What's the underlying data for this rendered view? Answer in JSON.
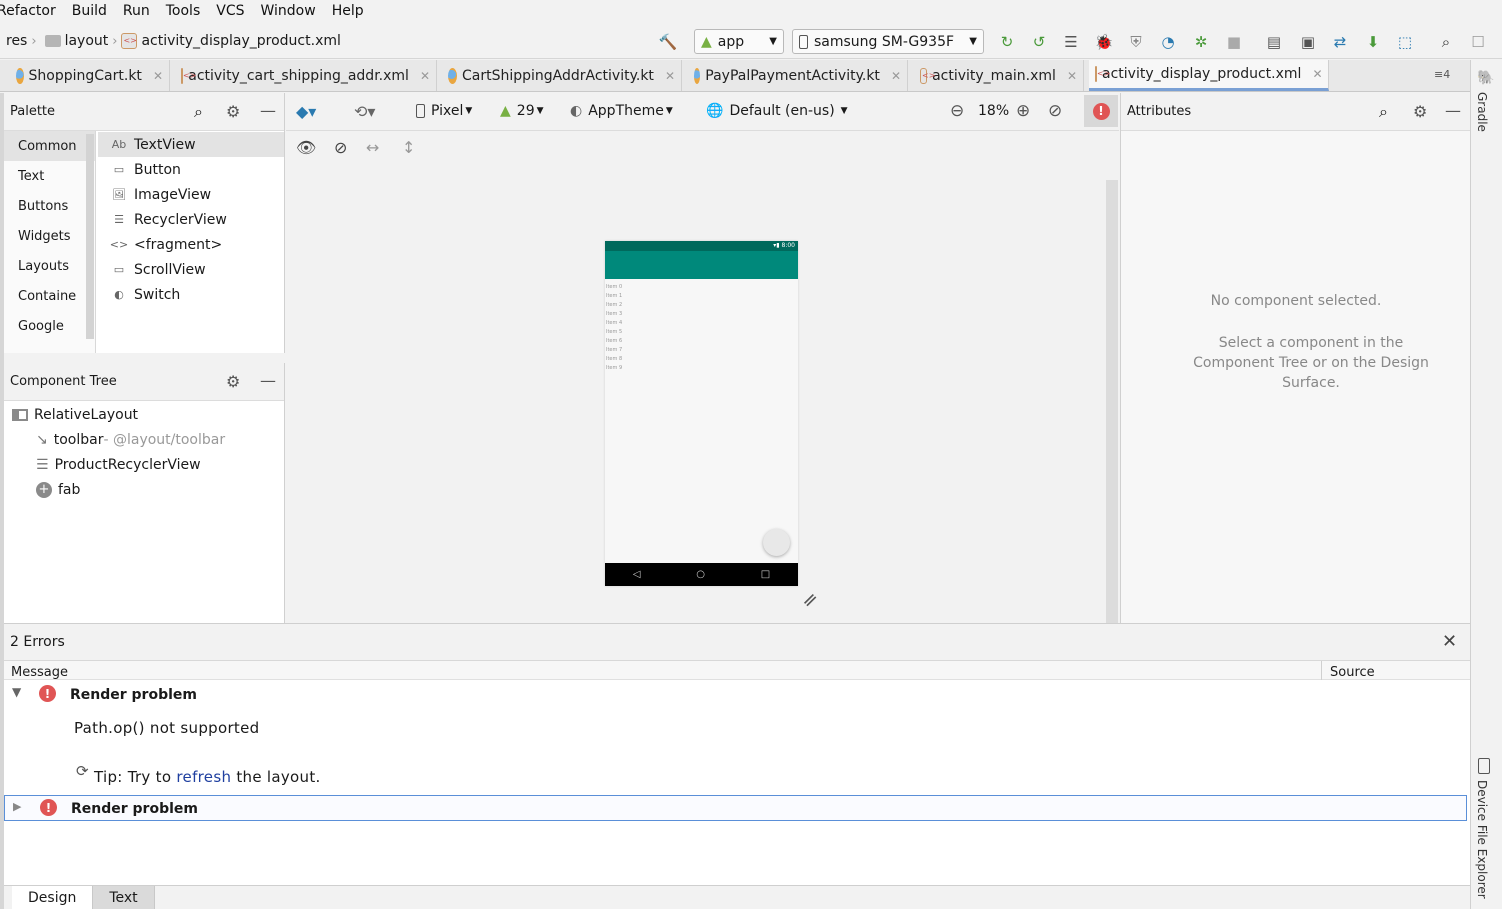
{
  "menu": [
    "Refactor",
    "Build",
    "Run",
    "Tools",
    "VCS",
    "Window",
    "Help"
  ],
  "breadcrumb": {
    "res": "res",
    "layout": "layout",
    "file": "activity_display_product.xml"
  },
  "run_config": "app",
  "device": "samsung SM-G935F",
  "tabs": [
    {
      "label": "ShoppingCart.kt",
      "type": "kt"
    },
    {
      "label": "activity_cart_shipping_addr.xml",
      "type": "xml"
    },
    {
      "label": "CartShippingAddrActivity.kt",
      "type": "kt"
    },
    {
      "label": "PayPalPaymentActivity.kt",
      "type": "kt"
    },
    {
      "label": "activity_main.xml",
      "type": "xml"
    },
    {
      "label": "activity_display_product.xml",
      "type": "xml"
    }
  ],
  "tab_overflow": "≡4",
  "palette": {
    "title": "Palette",
    "categories": [
      "Common",
      "Text",
      "Buttons",
      "Widgets",
      "Layouts",
      "Containe",
      "Google"
    ],
    "items": [
      "TextView",
      "Button",
      "ImageView",
      "RecyclerView",
      "<fragment>",
      "ScrollView",
      "Switch"
    ],
    "item_icons": [
      "Ab",
      "▭",
      "🖼",
      "☰",
      "<>",
      "▭",
      "◐"
    ]
  },
  "component_tree": {
    "title": "Component Tree",
    "root": "RelativeLayout",
    "children": [
      {
        "label": "toolbar",
        "hint": "- @layout/toolbar"
      },
      {
        "label": "ProductRecyclerView",
        "hint": ""
      },
      {
        "label": "fab",
        "hint": ""
      }
    ]
  },
  "design_toolbar": {
    "device": "Pixel",
    "api": "29",
    "theme": "AppTheme",
    "locale": "Default (en-us)",
    "zoom": "18%"
  },
  "phone": {
    "status_time": "8:00",
    "list_items": [
      "Item 0",
      "Item 1",
      "Item 2",
      "Item 3",
      "Item 4",
      "Item 5",
      "Item 6",
      "Item 7",
      "Item 8",
      "Item 9"
    ]
  },
  "attributes": {
    "title": "Attributes",
    "empty_title": "No component selected.",
    "empty_hint": "Select a component in the Component Tree or on the Design Surface."
  },
  "right_strip": {
    "gradle": "Gradle",
    "device_explorer": "Device File Explorer"
  },
  "errors": {
    "title": "2 Errors",
    "col_message": "Message",
    "col_source": "Source",
    "items": [
      {
        "title": "Render problem",
        "detail": "Path.op() not supported",
        "tip_prefix": "Tip: Try to ",
        "tip_link": "refresh",
        "tip_suffix": " the layout.",
        "expanded": true
      },
      {
        "title": "Render problem",
        "expanded": false
      }
    ]
  },
  "bottom_tabs": [
    "Design",
    "Text"
  ],
  "colors": {
    "app_bar": "#00897b",
    "status_bar": "#00695c",
    "error": "#e05555",
    "accent": "#7aa0d4"
  }
}
